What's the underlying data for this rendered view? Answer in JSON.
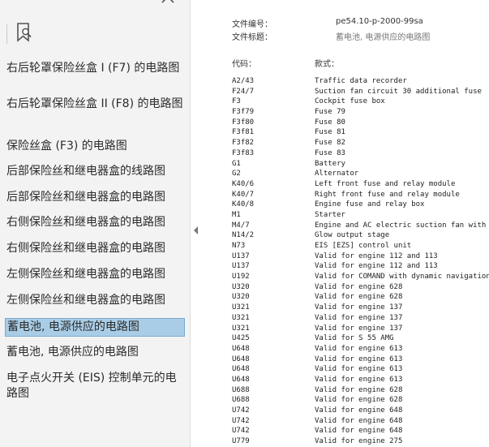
{
  "sidebar": {
    "items": [
      {
        "label": "右后轮罩保险丝盒 I (F7) 的电路图",
        "selected": false
      },
      {
        "label": "右后轮罩保险丝盒 II (F8) 的电路图",
        "selected": false
      },
      {
        "label": "保险丝盒 (F3) 的电路图",
        "selected": false
      },
      {
        "label": "后部保险丝和继电器盒的线路图",
        "selected": false
      },
      {
        "label": "后部保险丝和继电器盒的电路图",
        "selected": false
      },
      {
        "label": "右侧保险丝和继电器盒的电路图",
        "selected": false
      },
      {
        "label": "右侧保险丝和继电器盒的电路图",
        "selected": false
      },
      {
        "label": "左侧保险丝和继电器盒的电路图",
        "selected": false
      },
      {
        "label": "左侧保险丝和继电器盒的电路图",
        "selected": false
      },
      {
        "label": "蓄电池, 电源供应的电路图",
        "selected": true
      },
      {
        "label": "蓄电池, 电源供应的电路图",
        "selected": false
      },
      {
        "label": "电子点火开关 (EIS) 控制单元的电路图",
        "selected": false
      }
    ]
  },
  "document": {
    "file_number_label": "文件编号：",
    "file_number_value": "pe54.10-p-2000-99sa",
    "file_title_label": "文件标题：",
    "file_title_value": "蓄电池, 电源供应的电路图",
    "code_header": "代码：",
    "desc_header": "款式：",
    "rows": [
      {
        "code": "A2/43",
        "desc": "Traffic data recorder"
      },
      {
        "code": "F24/7",
        "desc": "Suction fan circuit 30 additional fuse"
      },
      {
        "code": "F3",
        "desc": "Cockpit fuse box"
      },
      {
        "code": "F3f79",
        "desc": "Fuse 79"
      },
      {
        "code": "F3f80",
        "desc": "Fuse 80"
      },
      {
        "code": "F3f81",
        "desc": "Fuse 81"
      },
      {
        "code": "F3f82",
        "desc": "Fuse 82"
      },
      {
        "code": "F3f83",
        "desc": "Fuse 83"
      },
      {
        "code": "G1",
        "desc": "Battery"
      },
      {
        "code": "G2",
        "desc": "Alternator"
      },
      {
        "code": "K40/6",
        "desc": "Left front fuse and relay module"
      },
      {
        "code": "K40/7",
        "desc": "Right front fuse and relay module"
      },
      {
        "code": "K40/8",
        "desc": "Engine fuse and relay box"
      },
      {
        "code": "M1",
        "desc": "Starter"
      },
      {
        "code": "M4/7",
        "desc": "Engine and AC electric suction fan with int"
      },
      {
        "code": "N14/2",
        "desc": "Glow output stage"
      },
      {
        "code": "N73",
        "desc": "EIS [EZS] control unit"
      },
      {
        "code": "U137",
        "desc": "Valid for engine 112 and 113"
      },
      {
        "code": "U137",
        "desc": "Valid for engine 112 and 113"
      },
      {
        "code": "U192",
        "desc": "Valid for COMAND with dynamic navigation"
      },
      {
        "code": "U320",
        "desc": "Valid for engine 628"
      },
      {
        "code": "U320",
        "desc": "Valid for engine 628"
      },
      {
        "code": "U321",
        "desc": "Valid for engine 137"
      },
      {
        "code": "U321",
        "desc": "Valid for engine 137"
      },
      {
        "code": "U321",
        "desc": "Valid for engine 137"
      },
      {
        "code": "U425",
        "desc": "Valid for S 55 AMG"
      },
      {
        "code": "U648",
        "desc": "Valid for engine 613"
      },
      {
        "code": "U648",
        "desc": "Valid for engine 613"
      },
      {
        "code": "U648",
        "desc": "Valid for engine 613"
      },
      {
        "code": "U648",
        "desc": "Valid for engine 613"
      },
      {
        "code": "U688",
        "desc": "Valid for engine 628"
      },
      {
        "code": "U688",
        "desc": "Valid for engine 628"
      },
      {
        "code": "U742",
        "desc": "Valid for engine 648"
      },
      {
        "code": "U742",
        "desc": "Valid for engine 648"
      },
      {
        "code": "U742",
        "desc": "Valid for engine 648"
      },
      {
        "code": "U779",
        "desc": "Valid for engine 275"
      }
    ]
  }
}
